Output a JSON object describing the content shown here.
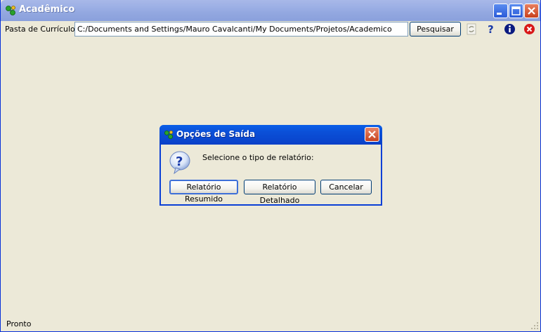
{
  "window": {
    "title": "Acadêmico",
    "icons": {
      "app": "green-molecule-icon",
      "minimize": "minimize-icon",
      "maximize": "maximize-icon",
      "close": "close-icon"
    }
  },
  "toolbar": {
    "folder_label": "Pasta de Currículos:",
    "folder_value": "C:/Documents and Settings/Mauro Cavalcanti/My Documents/Projetos/Academico",
    "search_label": "Pesquisar",
    "icons": [
      "refresh-icon",
      "help-icon",
      "info-icon",
      "exit-icon"
    ]
  },
  "status": {
    "text": "Pronto"
  },
  "dialog": {
    "title": "Opções de Saída",
    "prompt": "Selecione o tipo de relatório:",
    "buttons": {
      "summary": "Relatório Resumido",
      "detailed": "Relatório Detalhado",
      "cancel": "Cancelar"
    }
  },
  "colors": {
    "background": "#ece9d8",
    "title_active": "#0a48d0",
    "title_inactive": "#9aaee4",
    "close_red": "#c84420"
  }
}
